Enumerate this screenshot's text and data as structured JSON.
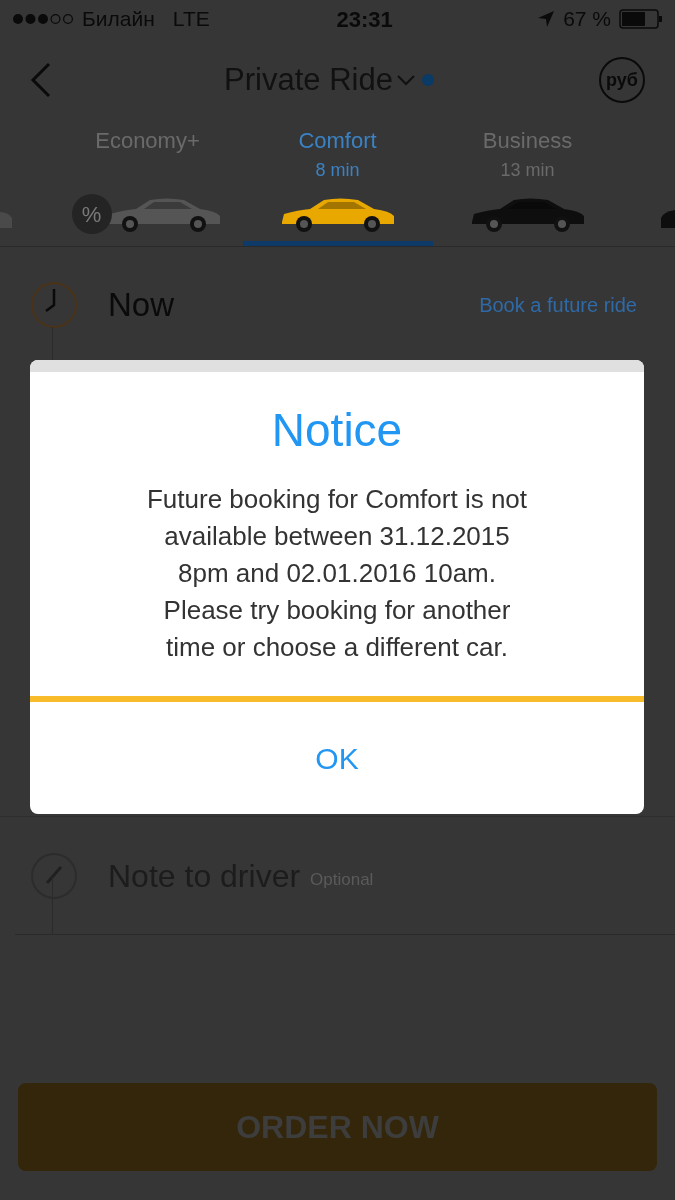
{
  "status_bar": {
    "carrier": "Билайн",
    "network": "LTE",
    "time": "23:31",
    "battery": "67 %"
  },
  "header": {
    "title": "Private Ride",
    "currency": "руб"
  },
  "tabs": [
    {
      "label": "Economy+",
      "badge": "%",
      "color": "#555555",
      "selected": false
    },
    {
      "label": "Comfort",
      "eta": "8 min",
      "color": "#e8a800",
      "selected": true
    },
    {
      "label": "Business",
      "eta": "13 min",
      "color": "#0e0e0e",
      "selected": false
    }
  ],
  "time_row": {
    "label": "Now",
    "link": "Book a future ride"
  },
  "note_row": {
    "label": "Note to driver",
    "hint": "Optional"
  },
  "order_button": "ORDER NOW",
  "dialog": {
    "title": "Notice",
    "message": "Future booking for Comfort is not available between 31.12.2015 8pm and 02.01.2016 10am. Please try booking for another time or choose a different car.",
    "button": "OK"
  }
}
